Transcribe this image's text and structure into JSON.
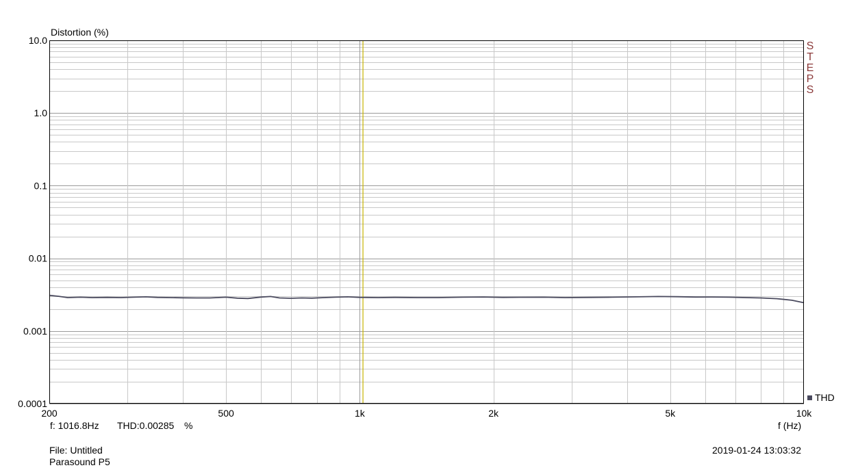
{
  "chart_data": {
    "type": "line",
    "title": "",
    "ylabel": "Distortion (%)",
    "xlabel": "f (Hz)",
    "xscale": "log",
    "yscale": "log",
    "xlim": [
      200,
      10000
    ],
    "ylim": [
      0.0001,
      10.0
    ],
    "grid": true,
    "x_ticks": [
      {
        "value": 200,
        "label": "200"
      },
      {
        "value": 500,
        "label": "500"
      },
      {
        "value": 1000,
        "label": "1k"
      },
      {
        "value": 2000,
        "label": "2k"
      },
      {
        "value": 5000,
        "label": "5k"
      },
      {
        "value": 10000,
        "label": "10k"
      }
    ],
    "y_ticks": [
      {
        "value": 10,
        "label": "10.0"
      },
      {
        "value": 1,
        "label": "1.0"
      },
      {
        "value": 0.1,
        "label": "0.1"
      },
      {
        "value": 0.01,
        "label": "0.01"
      },
      {
        "value": 0.001,
        "label": "0.001"
      },
      {
        "value": 0.0001,
        "label": "0.0001"
      }
    ],
    "cursor": {
      "x": 1016.8,
      "color": "#c8b400"
    },
    "series": [
      {
        "name": "THD",
        "color": "#4a4a5e",
        "x": [
          200,
          210,
          220,
          235,
          250,
          270,
          290,
          310,
          330,
          350,
          375,
          400,
          430,
          460,
          500,
          530,
          560,
          600,
          630,
          660,
          700,
          740,
          780,
          830,
          880,
          940,
          1000,
          1100,
          1200,
          1350,
          1500,
          1700,
          1900,
          2100,
          2300,
          2600,
          2900,
          3300,
          3700,
          4200,
          4700,
          5200,
          5700,
          6200,
          6800,
          7400,
          8000,
          8700,
          9400,
          10000
        ],
        "y": [
          0.0031,
          0.003,
          0.00288,
          0.00292,
          0.00288,
          0.0029,
          0.00288,
          0.00292,
          0.00295,
          0.0029,
          0.00288,
          0.00286,
          0.00285,
          0.00285,
          0.00292,
          0.00283,
          0.0028,
          0.00293,
          0.00298,
          0.00285,
          0.00282,
          0.00285,
          0.00283,
          0.00288,
          0.00292,
          0.00295,
          0.0029,
          0.00288,
          0.0029,
          0.00288,
          0.00288,
          0.00292,
          0.00294,
          0.0029,
          0.00291,
          0.00292,
          0.00288,
          0.0029,
          0.00292,
          0.00295,
          0.00298,
          0.00296,
          0.00293,
          0.00294,
          0.00292,
          0.00288,
          0.00285,
          0.00278,
          0.00265,
          0.00245
        ]
      }
    ]
  },
  "readout": {
    "freq": "f: 1016.8Hz",
    "thd": "THD:0.00285",
    "unit": "%"
  },
  "footer": {
    "file": "File: Untitled",
    "device": "Parasound P5",
    "timestamp": "2019-01-24 13:03:32"
  },
  "brand_letters": [
    "S",
    "T",
    "E",
    "P",
    "S"
  ],
  "brand_color": "#8b3a3a",
  "grid_color": "#c8c8c8"
}
